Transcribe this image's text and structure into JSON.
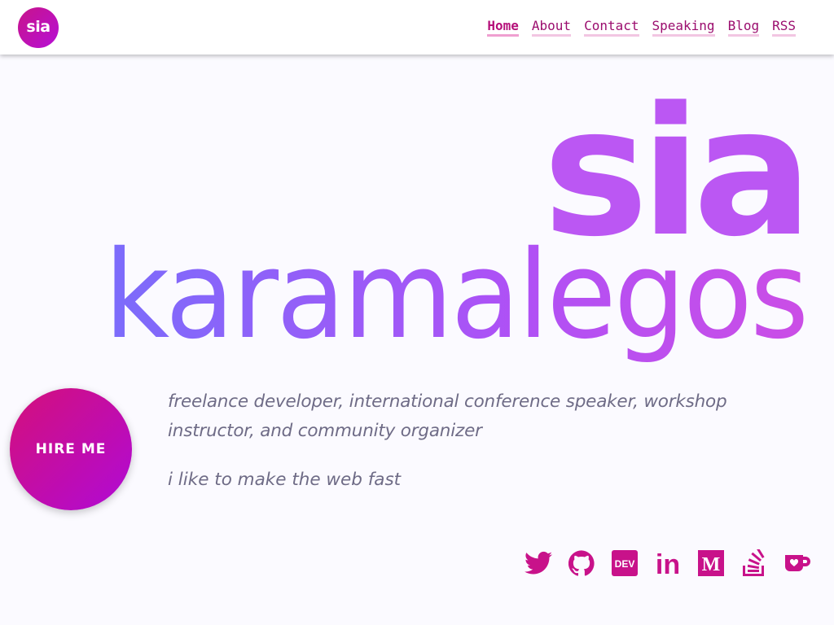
{
  "header": {
    "logo_text": "sia",
    "nav": [
      {
        "label": "Home",
        "active": true
      },
      {
        "label": "About"
      },
      {
        "label": "Contact"
      },
      {
        "label": "Speaking"
      },
      {
        "label": "Blog"
      },
      {
        "label": "RSS"
      }
    ]
  },
  "hero": {
    "first_name": "sia",
    "last_name": "karamalegos",
    "hire_button": "HIRE ME",
    "tagline": "freelance developer, international conference speaker, workshop instructor, and community organizer",
    "motto": "i like to make the web fast"
  },
  "social": [
    {
      "icon": "twitter-icon"
    },
    {
      "icon": "github-icon"
    },
    {
      "icon": "dev-icon",
      "text": "DEV"
    },
    {
      "icon": "linkedin-icon",
      "text": "in"
    },
    {
      "icon": "medium-icon",
      "text": "M"
    },
    {
      "icon": "stackoverflow-icon"
    },
    {
      "icon": "kofi-icon"
    }
  ],
  "colors": {
    "accent": "#c8128a",
    "first_name": "#bb57f3",
    "last_name_start": "#7b6cfb",
    "last_name_end": "#cb4ee6",
    "text": "#6e6b86"
  }
}
